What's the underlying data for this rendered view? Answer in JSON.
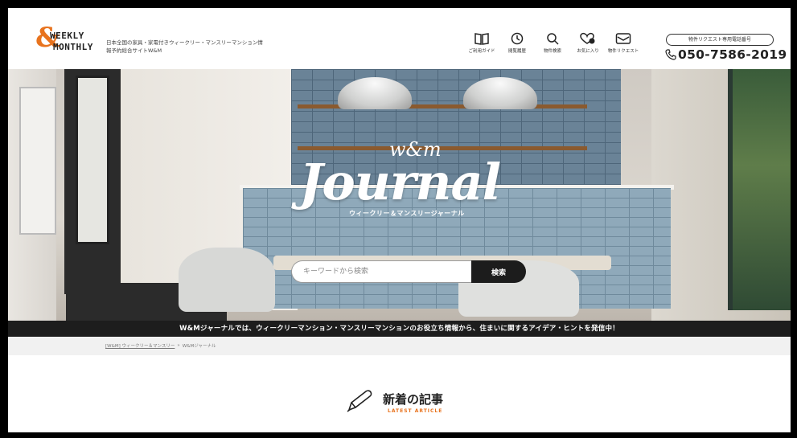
{
  "header": {
    "logo": {
      "amp": "&",
      "line1": "WEEKLY",
      "line2": "MONTHLY"
    },
    "tagline": "日本全国の家具・家電付きウィークリー・マンスリーマンション情報予約総合サイトW&M",
    "nav": [
      {
        "label": "ご利用ガイド",
        "icon": "book-icon"
      },
      {
        "label": "閲覧履歴",
        "icon": "clock-icon"
      },
      {
        "label": "物件検索",
        "icon": "search-icon"
      },
      {
        "label": "お気に入り",
        "icon": "heart-icon"
      },
      {
        "label": "物件リクエスト",
        "icon": "mail-icon"
      }
    ],
    "request_label": "物件リクエスト専用電話番号",
    "phone": "050-7586-2019"
  },
  "hero": {
    "logo_small": "w&m",
    "logo_big": "Journal",
    "logo_sub": "ウィークリー＆マンスリージャーナル",
    "search_placeholder": "キーワードから検索",
    "search_button": "検索"
  },
  "banner": "W&Mジャーナルでは、ウィークリーマンション・マンスリーマンションのお役立ち情報から、住まいに関するアイデア・ヒントを発信中！",
  "breadcrumb": {
    "home": "[W&M] ウィークリー＆マンスリー",
    "sep": "»",
    "current": "W&Mジャーナル"
  },
  "section": {
    "title_jp": "新着の記事",
    "title_en": "LATEST ARTICLE"
  },
  "colors": {
    "accent": "#e8731e",
    "dark": "#1d1d1d"
  }
}
